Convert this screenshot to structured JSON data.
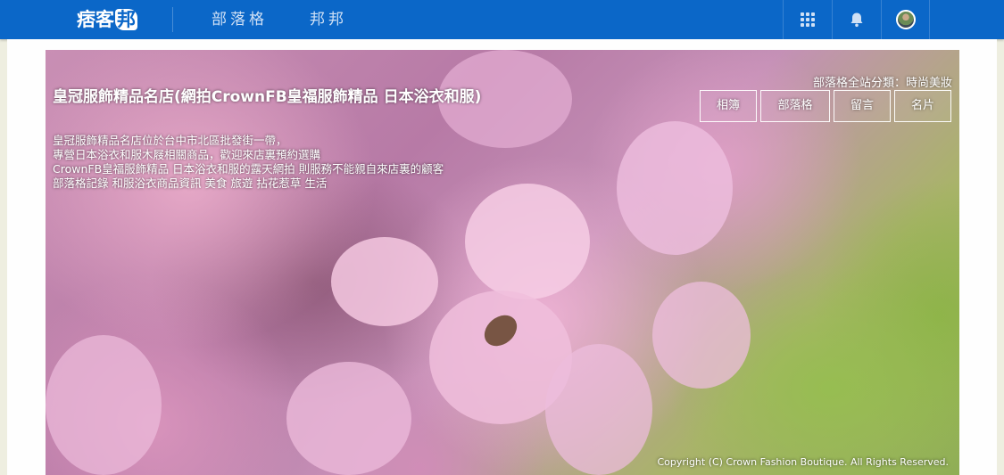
{
  "topbar": {
    "logo_text": "痞客",
    "logo_mark": "邦",
    "nav": [
      {
        "label": "部落格"
      },
      {
        "label": "邦邦"
      }
    ],
    "icons": [
      "apps-grid-icon",
      "bell-icon",
      "avatar"
    ]
  },
  "banner": {
    "title": "皇冠服飾精品名店(網拍CrownFB皇福服飾精品 日本浴衣和服)",
    "category": "部落格全站分類：時尚美妝",
    "description": [
      "皇冠服飾精品名店位於台中市北區批發街一帶，",
      "專營日本浴衣和服木屐相關商品，歡迎來店裏預約選購",
      "CrownFB皇福服飾精品 日本浴衣和服的露天網拍 則服務不能親自來店裏的顧客",
      "部落格記錄 和服浴衣商品資訊 美食 旅遊 拈花惹草 生活"
    ],
    "buttons": [
      {
        "label": "相簿"
      },
      {
        "label": "部落格"
      },
      {
        "label": "留言"
      },
      {
        "label": "名片"
      }
    ],
    "copyright": "Copyright (C)  Crown Fashion Boutique.  All  Rights Reserved."
  },
  "colors": {
    "topbar": "#0b67c8",
    "page_background": "#eeeee0"
  }
}
